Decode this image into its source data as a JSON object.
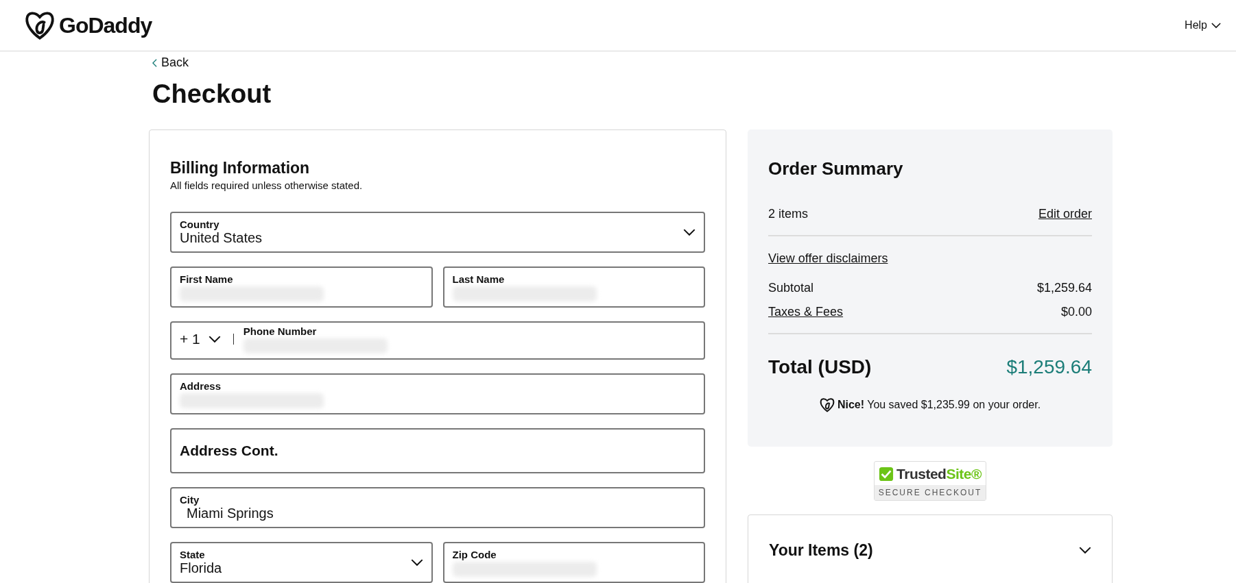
{
  "header": {
    "logo_text": "GoDaddy",
    "help": "Help"
  },
  "back": "Back",
  "title": "Checkout",
  "billing": {
    "title": "Billing Information",
    "note": "All fields required unless otherwise stated.",
    "rows": [
      [
        {
          "kind": "select",
          "label": "Country",
          "value": "United States"
        }
      ],
      [
        {
          "kind": "text",
          "label": "First Name",
          "redacted": true
        },
        {
          "kind": "text",
          "label": "Last Name",
          "redacted": true
        }
      ],
      [
        {
          "kind": "phone",
          "code": "+ 1",
          "label": "Phone Number",
          "redacted": true
        }
      ],
      [
        {
          "kind": "text",
          "label": "Address",
          "redacted": true
        }
      ],
      [
        {
          "kind": "empty",
          "placeholder": "Address Cont."
        }
      ],
      [
        {
          "kind": "text",
          "label": "City",
          "value": "Miami Springs"
        }
      ],
      [
        {
          "kind": "select",
          "label": "State",
          "value": "Florida"
        },
        {
          "kind": "text",
          "label": "Zip Code",
          "redacted": true
        }
      ]
    ]
  },
  "summary": {
    "title": "Order Summary",
    "items_count": "2 items",
    "edit": "Edit order",
    "disclaimers": "View offer disclaimers",
    "lines": [
      {
        "kind": "plain",
        "label": "Subtotal",
        "amount": "$1,259.64"
      },
      {
        "kind": "link",
        "label": "Taxes & Fees",
        "amount": "$0.00"
      }
    ],
    "total_label": "Total (USD)",
    "total": "$1,259.64",
    "savings": "**Nice!** You saved $1,235.99 on your order."
  },
  "badge": {
    "brand": "Trusted",
    "brand_accent": "Site®",
    "subtitle": "SECURE CHECKOUT"
  },
  "items_panel": {
    "title": "Your Items (2)",
    "expanded": false
  }
}
